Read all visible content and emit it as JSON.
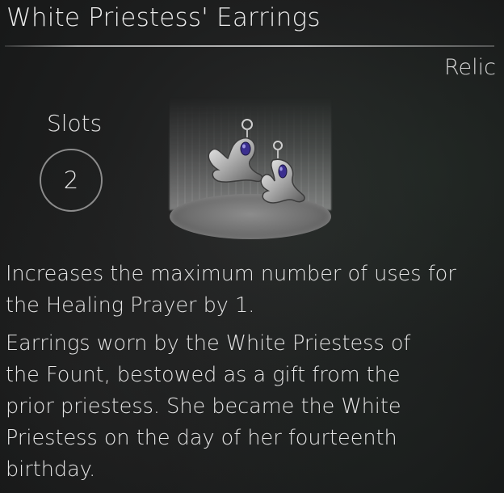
{
  "item": {
    "name": "White Priestess' Earrings",
    "category": "Relic",
    "slots_label": "Slots",
    "slots_value": "2",
    "effect_lines": [
      "Increases the maximum number of uses for",
      "the Healing Prayer by 1."
    ],
    "lore_lines": [
      "Earrings worn by the White Priestess of",
      "the Fount, bestowed as a gift from the",
      "prior priestess. She became the White",
      "Priestess on the day of her fourteenth",
      "birthday."
    ],
    "icon": "earrings-icon",
    "gem_color": "#3b2f8f"
  }
}
